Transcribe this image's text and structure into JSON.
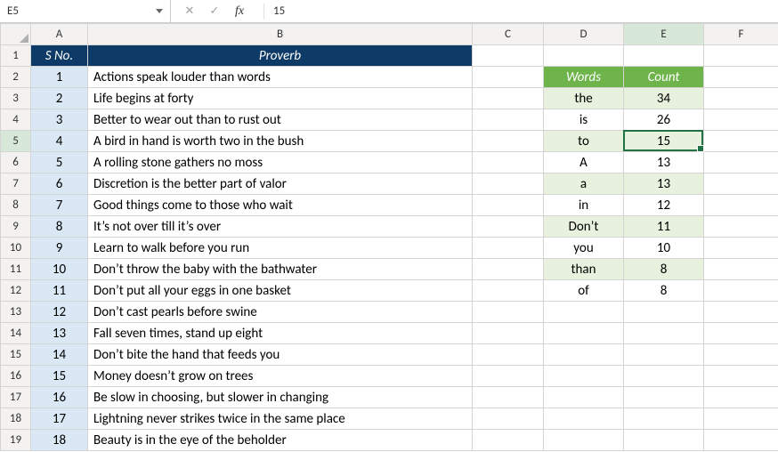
{
  "formula_bar": {
    "name_box": "E5",
    "cancel_label": "✕",
    "enter_label": "✓",
    "fx_label": "fx",
    "formula": "15"
  },
  "columns": [
    "A",
    "B",
    "C",
    "D",
    "E",
    "F"
  ],
  "row_numbers": [
    "1",
    "2",
    "3",
    "4",
    "5",
    "6",
    "7",
    "8",
    "9",
    "10",
    "11",
    "12",
    "13",
    "14",
    "15",
    "16",
    "17",
    "18",
    "19"
  ],
  "proverbs_table": {
    "headers": {
      "sno": "S No.",
      "proverb": "Proverb"
    },
    "rows": [
      {
        "sno": "1",
        "text": "Actions speak louder than words"
      },
      {
        "sno": "2",
        "text": "Life begins at forty"
      },
      {
        "sno": "3",
        "text": "Better to wear out than to rust out"
      },
      {
        "sno": "4",
        "text": "A bird in hand is worth two in the bush"
      },
      {
        "sno": "5",
        "text": "A rolling stone gathers no moss"
      },
      {
        "sno": "6",
        "text": "Discretion is the better part of valor"
      },
      {
        "sno": "7",
        "text": "Good things come to those who wait"
      },
      {
        "sno": "8",
        "text": "It’s not over till it’s over"
      },
      {
        "sno": "9",
        "text": "Learn to walk before you run"
      },
      {
        "sno": "10",
        "text": "Don’t throw the baby with the bathwater"
      },
      {
        "sno": "11",
        "text": "Don’t put all your eggs in one basket"
      },
      {
        "sno": "12",
        "text": "Don’t cast pearls before swine"
      },
      {
        "sno": "13",
        "text": "Fall seven times, stand up eight"
      },
      {
        "sno": "14",
        "text": "Don’t bite the hand that feeds you"
      },
      {
        "sno": "15",
        "text": "Money doesn’t grow on trees"
      },
      {
        "sno": "16",
        "text": "Be slow in choosing, but slower in changing"
      },
      {
        "sno": "17",
        "text": "Lightning never strikes twice in the same place"
      },
      {
        "sno": "18",
        "text": "Beauty is in the eye of the beholder"
      }
    ]
  },
  "word_count_table": {
    "headers": {
      "words": "Words",
      "count": "Count"
    },
    "rows": [
      {
        "word": "the",
        "count": "34"
      },
      {
        "word": "is",
        "count": "26"
      },
      {
        "word": "to",
        "count": "15"
      },
      {
        "word": "A",
        "count": "13"
      },
      {
        "word": "a",
        "count": "13"
      },
      {
        "word": "in",
        "count": "12"
      },
      {
        "word": "Don’t",
        "count": "11"
      },
      {
        "word": "you",
        "count": "10"
      },
      {
        "word": "than",
        "count": "8"
      },
      {
        "word": "of",
        "count": "8"
      }
    ]
  },
  "selection": {
    "cell": "E5",
    "col_index": 5,
    "row_index": 5
  },
  "colors": {
    "navy": "#0d3a66",
    "green_hdr": "#6eb44a",
    "green_band": "#e7f1dd",
    "selection": "#217346"
  }
}
